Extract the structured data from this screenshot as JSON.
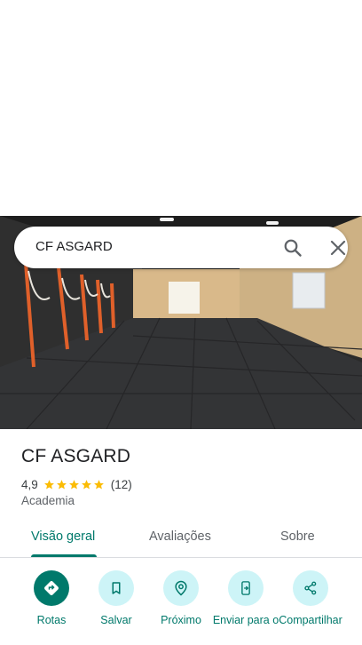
{
  "search": {
    "query": "CF ASGARD"
  },
  "place": {
    "name": "CF ASGARD",
    "rating": "4,9",
    "review_count": "(12)",
    "stars": 5,
    "category": "Academia"
  },
  "tabs": [
    {
      "label": "Visão geral",
      "active": true
    },
    {
      "label": "Avaliações",
      "active": false
    },
    {
      "label": "Sobre",
      "active": false
    }
  ],
  "actions": [
    {
      "label": "Rotas",
      "icon": "directions-icon"
    },
    {
      "label": "Salvar",
      "icon": "bookmark-icon"
    },
    {
      "label": "Próximo",
      "icon": "nearby-icon"
    },
    {
      "label": "Enviar para o",
      "icon": "send-to-phone-icon"
    },
    {
      "label": "Compartilhar",
      "icon": "share-icon"
    }
  ],
  "colors": {
    "accent": "#00796b",
    "accent_light": "#cdf4f7",
    "star": "#fbbc04"
  }
}
